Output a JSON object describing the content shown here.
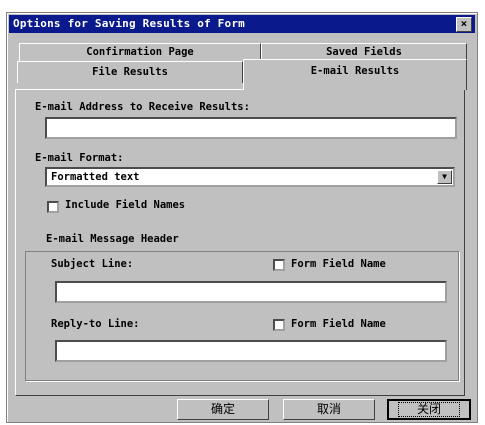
{
  "window": {
    "title": "Options for Saving Results of Form",
    "close_glyph": "×"
  },
  "tabs": [
    {
      "label": "Confirmation Page"
    },
    {
      "label": "Saved Fields"
    },
    {
      "label": "File Results"
    },
    {
      "label": "E-mail Results",
      "active": true
    }
  ],
  "email_address": {
    "label": "E-mail Address to Receive Results:",
    "value": ""
  },
  "email_format": {
    "label": "E-mail Format:",
    "selected": "Formatted text"
  },
  "include_field_names": {
    "label": "Include Field Names",
    "checked": false
  },
  "message_header": {
    "title": "E-mail Message Header",
    "subject": {
      "label": "Subject Line:",
      "value": "",
      "checkbox_label": "Form Field Name",
      "checked": false
    },
    "reply_to": {
      "label": "Reply-to Line:",
      "value": "",
      "checkbox_label": "Form Field Name",
      "checked": false
    }
  },
  "buttons": {
    "ok": "确定",
    "cancel": "取消",
    "close": "关闭"
  },
  "colors": {
    "titlebar": "#0a1a8c",
    "face": "#c0c0c0"
  },
  "icons": {
    "close": "close-icon",
    "dropdown": "chevron-down-icon"
  }
}
